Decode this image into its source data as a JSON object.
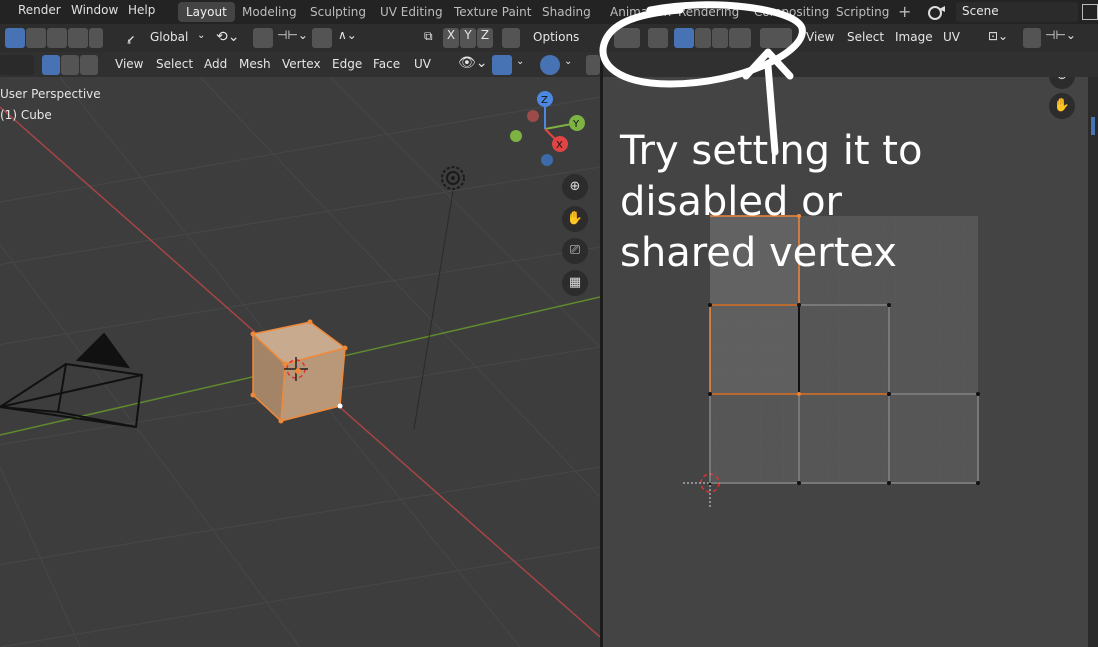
{
  "menubar": {
    "items": [
      "Render",
      "Window",
      "Help"
    ],
    "tabs": [
      {
        "label": "Layout",
        "active": true
      },
      {
        "label": "Modeling"
      },
      {
        "label": "Sculpting"
      },
      {
        "label": "UV Editing"
      },
      {
        "label": "Texture Paint"
      },
      {
        "label": "Shading"
      },
      {
        "label": "Animation"
      },
      {
        "label": "Rendering"
      },
      {
        "label": "Compositing"
      },
      {
        "label": "Scripting"
      }
    ],
    "add_label": "+",
    "scene_label": "Scene"
  },
  "toolbar": {
    "transform_orientation": "Global",
    "axis_x": "X",
    "axis_y": "Y",
    "axis_z": "Z",
    "options_label": "Options",
    "uv_menus": [
      "View",
      "Select",
      "Image",
      "UV"
    ]
  },
  "viewport_header": {
    "menus": [
      "View",
      "Select",
      "Add",
      "Mesh",
      "Vertex",
      "Edge",
      "Face",
      "UV"
    ]
  },
  "viewport_3d": {
    "view_name": "User Perspective",
    "object_name": "(1) Cube"
  },
  "annotation": {
    "text": "Try setting it to disabled or shared vertex",
    "color": "#ffffff"
  },
  "colors": {
    "accent_blue": "#4772b3",
    "selection_orange": "#f0883a",
    "axis_x_red": "#e14444",
    "axis_y_green": "#7cb342",
    "axis_z_blue": "#4d88e0"
  },
  "icons": [
    "zoom-icon",
    "hand-pan-icon",
    "camera-icon",
    "grid-ortho-icon",
    "uv-sticky-select-icon",
    "gizmo-x",
    "gizmo-y",
    "gizmo-z"
  ]
}
